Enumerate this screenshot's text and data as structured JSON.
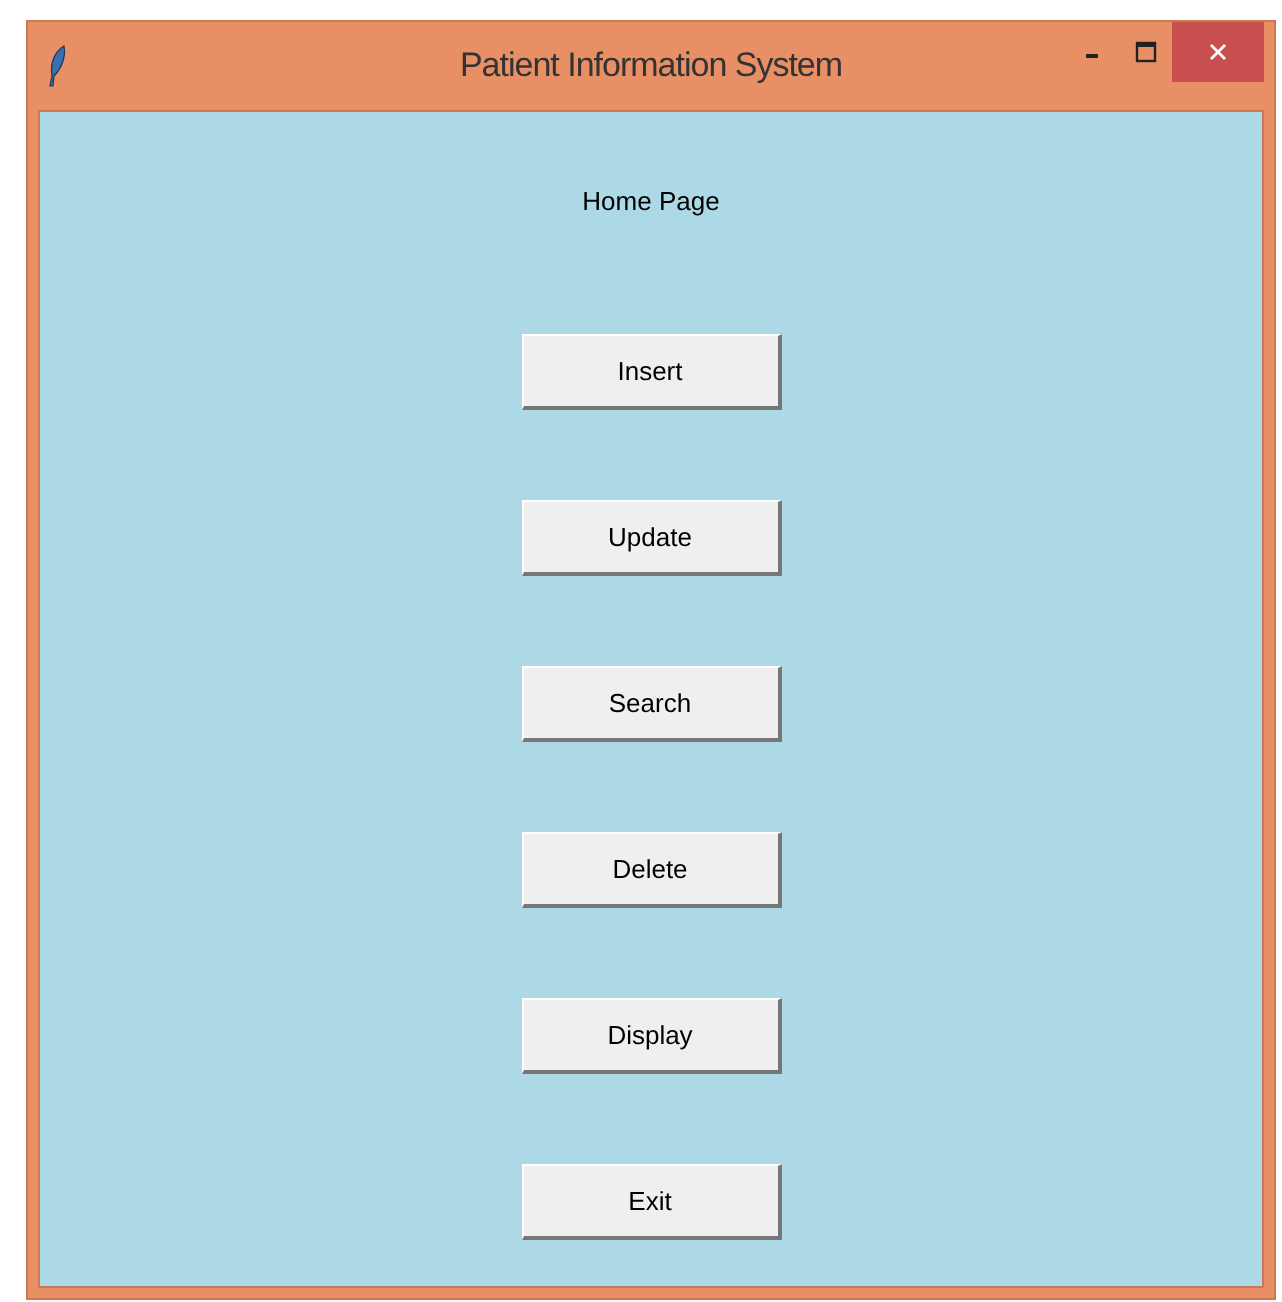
{
  "window": {
    "title": "Patient Information System"
  },
  "heading": "Home Page",
  "buttons": [
    "Insert",
    "Update",
    "Search",
    "Delete",
    "Display",
    "Exit"
  ]
}
